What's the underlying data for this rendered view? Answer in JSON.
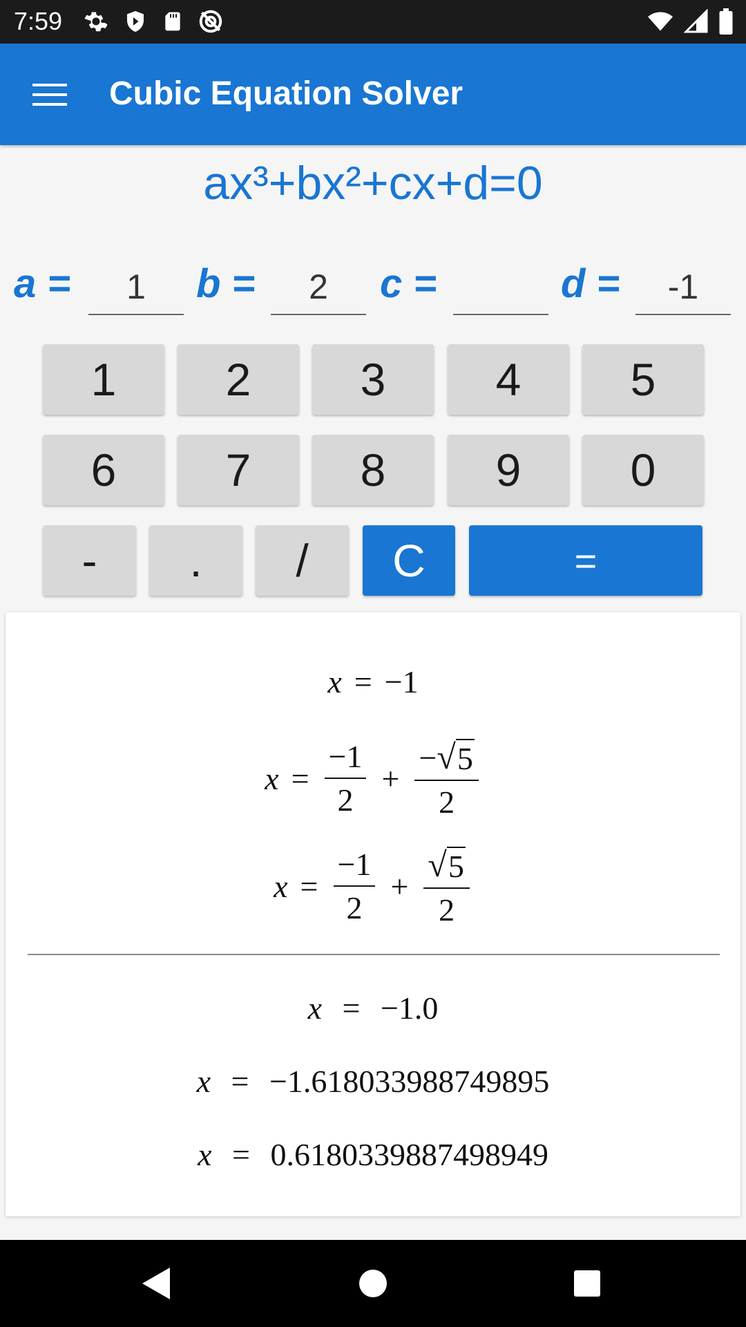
{
  "status_bar": {
    "time": "7:59",
    "left_icons": [
      "gear-icon",
      "shield-icon",
      "sd-card-icon",
      "no-location-icon"
    ],
    "right_icons": [
      "wifi-icon",
      "signal-icon",
      "battery-icon"
    ]
  },
  "app_bar": {
    "title": "Cubic Equation Solver",
    "menu_icon": "hamburger-menu-icon"
  },
  "equation": "ax³+bx²+cx+d=0",
  "coefficients": {
    "a": {
      "label": "a =",
      "value": "1"
    },
    "b": {
      "label": "b =",
      "value": "2"
    },
    "c": {
      "label": "c =",
      "value": ""
    },
    "d": {
      "label": "d =",
      "value": "-1"
    }
  },
  "keypad": {
    "row1": [
      "1",
      "2",
      "3",
      "4",
      "5"
    ],
    "row2": [
      "6",
      "7",
      "8",
      "9",
      "0"
    ],
    "row3": [
      "-",
      ".",
      "/",
      "C",
      "="
    ]
  },
  "results": {
    "exact": {
      "root1": {
        "lhs": "x",
        "eq": "=",
        "value": "−1"
      },
      "root2": {
        "lhs": "x",
        "eq": "=",
        "num1": "−1",
        "den1": "2",
        "plus": "+",
        "num2_sign": "−",
        "num2_radicand": "5",
        "den2": "2"
      },
      "root3": {
        "lhs": "x",
        "eq": "=",
        "num1": "−1",
        "den1": "2",
        "plus": "+",
        "num2_radicand": "5",
        "den2": "2"
      }
    },
    "decimal": {
      "root1": "−1.0",
      "root2": "−1.618033988749895",
      "root3": "0.6180339887498949"
    },
    "variable": "x",
    "eq": "="
  },
  "nav_bar": {
    "icons": [
      "back-icon",
      "home-icon",
      "recents-icon"
    ]
  },
  "colors": {
    "primary": "#1976d2",
    "status_bar": "#1b1b1b",
    "key_gray": "#d8d8d8",
    "background": "#f5f5f5"
  }
}
